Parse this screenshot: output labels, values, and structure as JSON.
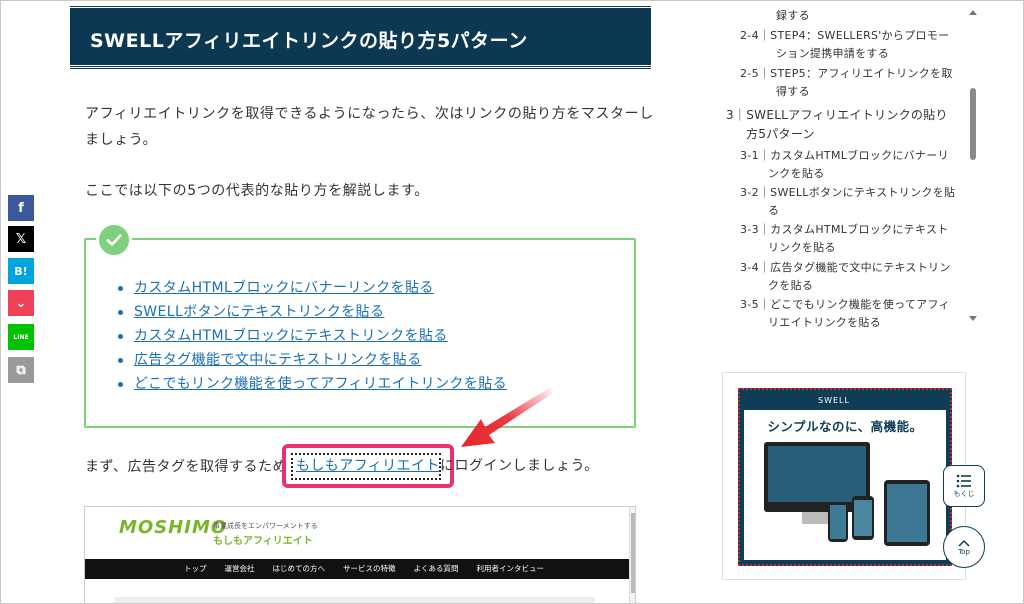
{
  "article": {
    "heading": "SWELLアフィリエイトリンクの貼り方5パターン",
    "para1_line1": "アフィリエイトリンクを取得できるようになったら、次はリンクの貼り方をマスターし",
    "para1_line2": "ましょう。",
    "para2": "ここでは以下の5つの代表的な貼り方を解説します。",
    "check_list": [
      "カスタムHTMLブロックにバナーリンクを貼る",
      "SWELLボタンにテキストリンクを貼る",
      "カスタムHTMLブロックにテキストリンクを貼る",
      "広告タグ機能で文中にテキストリンクを貼る",
      "どこでもリンク機能を使ってアフィリエイトリンクを貼る"
    ],
    "line_before_link": "まず、広告タグを取得するため",
    "moshimo_link": "もしもアフィリエイト",
    "line_after_link": "にログインしましょう。"
  },
  "embedded_screenshot": {
    "logo": "MOSHIMO",
    "tagline": "事業成長をエンパワーメントする",
    "site_name": "もしもアフィリエイト",
    "nav": [
      "トップ",
      "運営会社",
      "はじめての方へ",
      "サービスの特徴",
      "よくある質問",
      "利用者インタビュー"
    ]
  },
  "share": {
    "facebook": "f",
    "x": "𝕏",
    "hatena": "B!",
    "pocket": "⌄",
    "line": "LINE",
    "copy": "⧉"
  },
  "toc": {
    "items": [
      {
        "text": "録する",
        "indent": 2
      },
      {
        "text": "2-4｜STEP4：SWELLERS'からプロモー",
        "indent": 1
      },
      {
        "text": "ション提携申請をする",
        "indent": 2
      },
      {
        "text": "2-5｜STEP5：アフィリエイトリンクを取",
        "indent": 1
      },
      {
        "text": "得する",
        "indent": 2
      },
      {
        "text": "3｜SWELLアフィリエイトリンクの貼り",
        "indent": 0
      },
      {
        "text": "方5パターン",
        "indent": 3
      },
      {
        "text": "3-1｜カスタムHTMLブロックにバナーリ",
        "indent": 1
      },
      {
        "text": "ンクを貼る",
        "indent": 2
      },
      {
        "text": "3-2｜SWELLボタンにテキストリンクを貼",
        "indent": 1
      },
      {
        "text": "る",
        "indent": 2
      },
      {
        "text": "3-3｜カスタムHTMLブロックにテキスト",
        "indent": 1
      },
      {
        "text": "リンクを貼る",
        "indent": 2
      },
      {
        "text": "3-4｜広告タグ機能で文中にテキストリン",
        "indent": 1
      },
      {
        "text": "クを貼る",
        "indent": 2
      },
      {
        "text": "3-5｜どこでもリンク機能を使ってアフィ",
        "indent": 1
      },
      {
        "text": "リエイトリンクを貼る",
        "indent": 2
      }
    ]
  },
  "ad": {
    "logo": "SWELL",
    "copy": "シンプルなのに、高機能。"
  },
  "floating": {
    "toc_label": "もくじ",
    "top_label": "Top"
  },
  "colors": {
    "heading_bg": "#0c3852",
    "check_green": "#7ed07e",
    "link_blue": "#1a6fb5",
    "highlight_pink": "#e8326f",
    "arrow_red": "#e8232b"
  }
}
